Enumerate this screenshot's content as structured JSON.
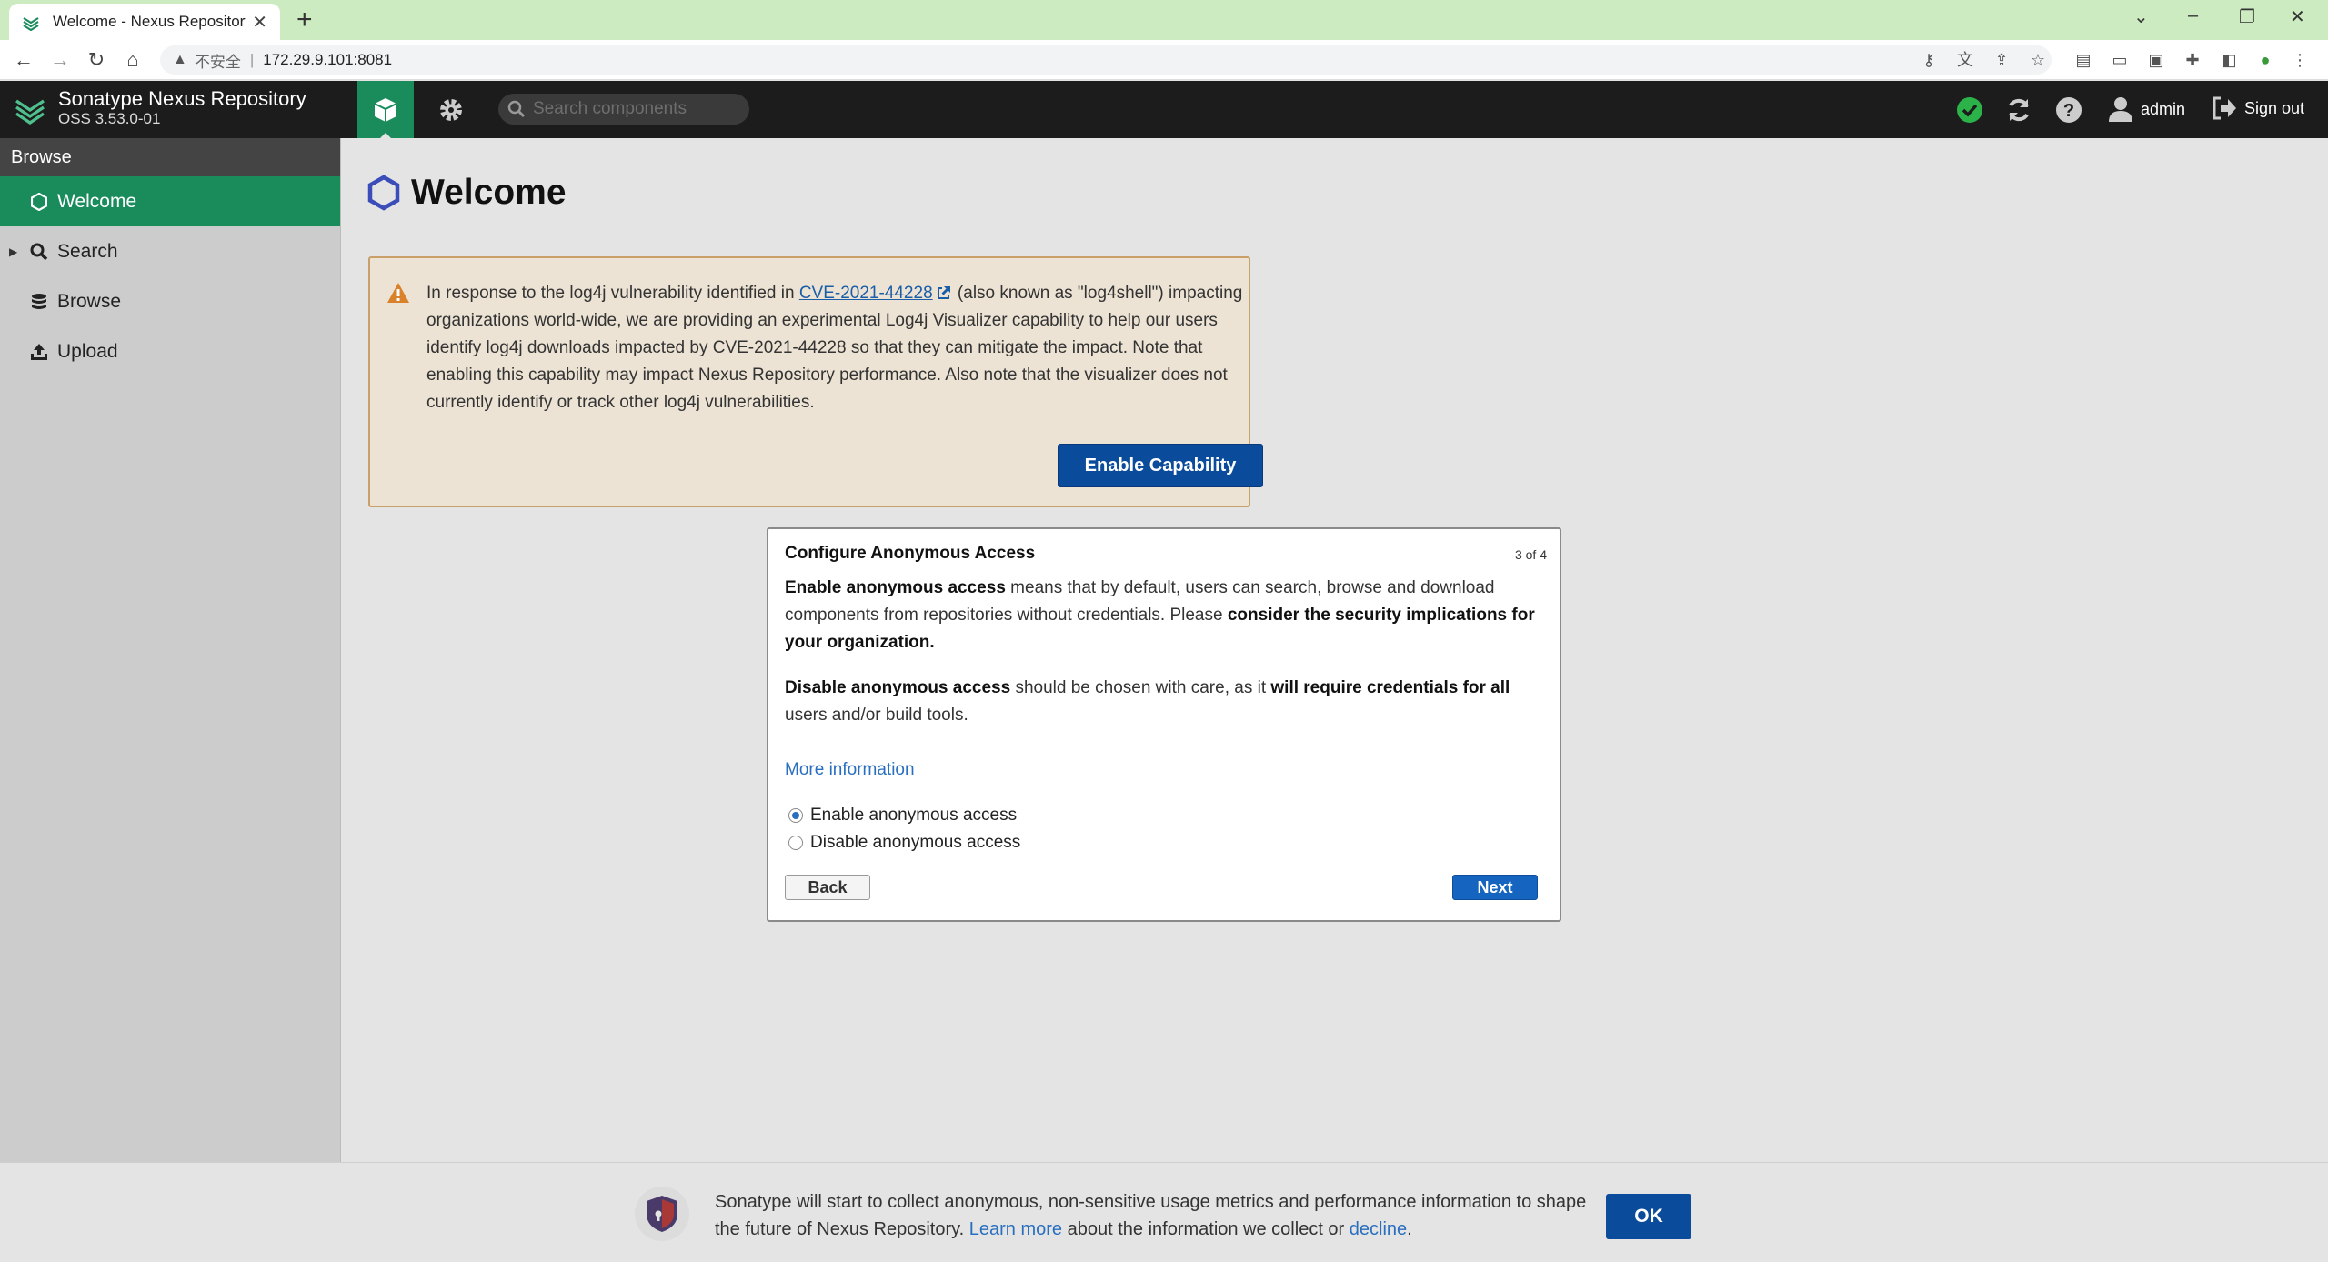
{
  "browser": {
    "tab_title": "Welcome - Nexus Repository",
    "address_insecure": "不安全",
    "address_separator": "|",
    "address_url": "172.29.9.101:8081"
  },
  "header": {
    "app_name": "Sonatype Nexus Repository",
    "version": "OSS 3.53.0-01",
    "search_placeholder": "Search components",
    "username": "admin",
    "signout_label": "Sign out",
    "accent_color": "#1a8c5c"
  },
  "sidebar": {
    "title": "Browse",
    "items": [
      {
        "label": "Welcome",
        "icon": "hexagon-icon",
        "active": true
      },
      {
        "label": "Search",
        "icon": "search-icon",
        "active": false
      },
      {
        "label": "Browse",
        "icon": "database-icon",
        "active": false
      },
      {
        "label": "Upload",
        "icon": "upload-icon",
        "active": false
      }
    ]
  },
  "main": {
    "title": "Welcome",
    "notice": {
      "text_before_link": "In response to the log4j vulnerability identified in ",
      "link": "CVE-2021-44228",
      "text_after_link": " (also known as \"log4shell\") impacting organizations world-wide, we are providing an experimental Log4j Visualizer capability to help our users identify log4j downloads impacted by CVE-2021-44228 so that they can mitigate the impact. Note that enabling this capability may impact Nexus Repository performance. Also note that the visualizer does not currently identify or track other log4j vulnerabilities.",
      "button": "Enable Capability"
    }
  },
  "dialog": {
    "title": "Configure Anonymous Access",
    "step": "3 of 4",
    "p1_b1": "Enable anonymous access",
    "p1_t1": " means that by default, users can search, browse and download components from repositories without credentials. Please ",
    "p1_b2": "consider the security implications for your organization.",
    "p2_b1": "Disable anonymous access",
    "p2_t1": " should be chosen with care, as it ",
    "p2_b2": "will require credentials for all",
    "p2_t2": " users and/or build tools.",
    "more_info": "More information",
    "options": [
      {
        "label": "Enable anonymous access",
        "selected": true
      },
      {
        "label": "Disable anonymous access",
        "selected": false
      }
    ],
    "back": "Back",
    "next": "Next"
  },
  "metrics": {
    "text1": "Sonatype will start to collect anonymous, non-sensitive usage metrics and performance information to shape the future of Nexus Repository. ",
    "learn_more": "Learn more",
    "text2": " about the information we collect or ",
    "decline": "decline",
    "text3": ".",
    "ok": "OK"
  }
}
